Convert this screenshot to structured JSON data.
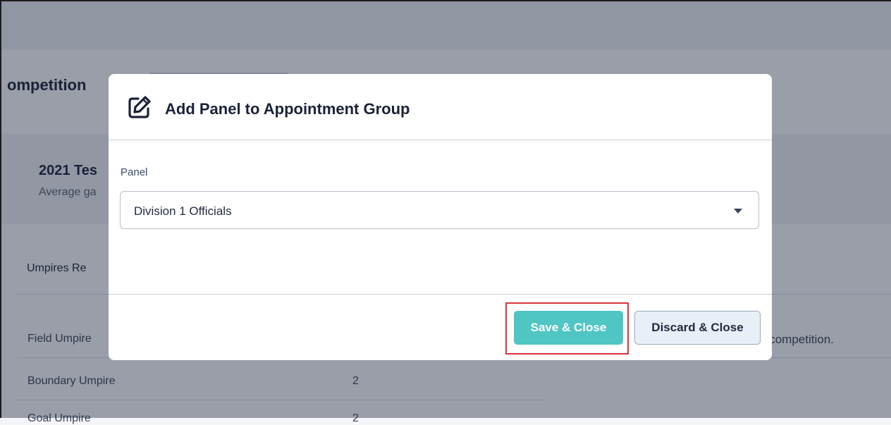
{
  "background": {
    "competition_title": "ompetition",
    "season_title": "2021 Tes",
    "season_subtitle": "Average ga",
    "umpires_required_heading": "Umpires Re",
    "rows": [
      {
        "label": "Field Umpire",
        "value": ""
      },
      {
        "label": "Boundary Umpire",
        "value": "2"
      },
      {
        "label": "Goal Umpire",
        "value": "2"
      }
    ],
    "side_note": "s competition."
  },
  "modal": {
    "title": "Add Panel to Appointment Group",
    "icon": "edit-icon",
    "panel_label": "Panel",
    "panel_selected": "Division 1 Officials",
    "save_label": "Save & Close",
    "discard_label": "Discard & Close"
  },
  "colors": {
    "accent": "#4fc6c4",
    "highlight": "#d9343a",
    "overlay": "rgba(24,34,58,0.44)"
  }
}
